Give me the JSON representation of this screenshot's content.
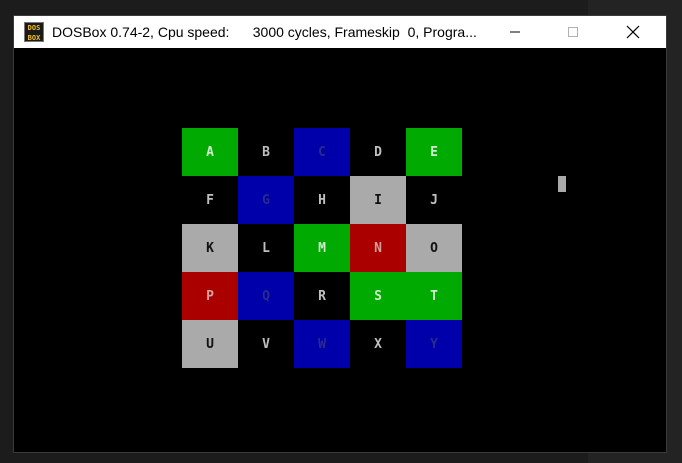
{
  "window": {
    "icon_text": "DOS BOX",
    "title": "DOSBox 0.74-2, Cpu speed:      3000 cycles, Frameskip  0, Progra...",
    "controls": [
      "minimize",
      "maximize",
      "close"
    ]
  },
  "palette": {
    "green": "#00aa00",
    "blue": "#0000aa",
    "gray": "#aaaaaa",
    "red": "#aa0000",
    "black": "#000000"
  },
  "text_colors": {
    "on_green": "#cdeecd",
    "on_blue": "#2a2a8f",
    "on_gray": "#111111",
    "on_red": "#d9a0a0",
    "on_black": "#bfbfbf"
  },
  "grid": {
    "rows": [
      [
        {
          "letter": "A",
          "color": "green"
        },
        {
          "letter": "B",
          "color": "black"
        },
        {
          "letter": "C",
          "color": "blue"
        },
        {
          "letter": "D",
          "color": "black"
        },
        {
          "letter": "E",
          "color": "green"
        }
      ],
      [
        {
          "letter": "F",
          "color": "black"
        },
        {
          "letter": "G",
          "color": "blue"
        },
        {
          "letter": "H",
          "color": "black"
        },
        {
          "letter": "I",
          "color": "gray"
        },
        {
          "letter": "J",
          "color": "black"
        }
      ],
      [
        {
          "letter": "K",
          "color": "gray"
        },
        {
          "letter": "L",
          "color": "black"
        },
        {
          "letter": "M",
          "color": "green"
        },
        {
          "letter": "N",
          "color": "red"
        },
        {
          "letter": "O",
          "color": "gray"
        }
      ],
      [
        {
          "letter": "P",
          "color": "red"
        },
        {
          "letter": "Q",
          "color": "blue"
        },
        {
          "letter": "R",
          "color": "black"
        },
        {
          "letter": "S",
          "color": "green"
        },
        {
          "letter": "T",
          "color": "green"
        }
      ],
      [
        {
          "letter": "U",
          "color": "gray"
        },
        {
          "letter": "V",
          "color": "black"
        },
        {
          "letter": "W",
          "color": "blue"
        },
        {
          "letter": "X",
          "color": "black"
        },
        {
          "letter": "Y",
          "color": "blue"
        }
      ]
    ]
  },
  "cursor": {
    "icon": "block-text-cursor"
  }
}
